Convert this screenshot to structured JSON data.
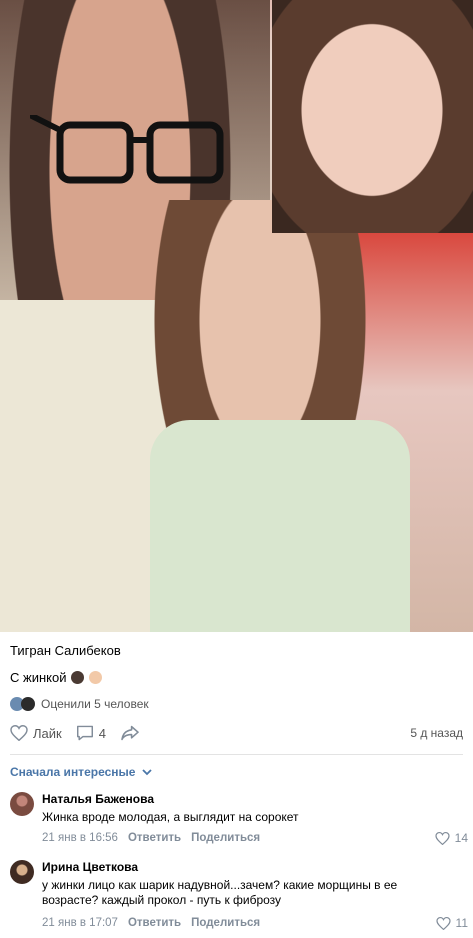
{
  "post": {
    "author": "Тигран Салибеков",
    "text": "С жинкой",
    "rated_text": "Оценили 5 человек",
    "like_label": "Лайк",
    "comments_count": "4",
    "time_ago": "5 д назад"
  },
  "comments_header": {
    "sort_label": "Сначала интересные"
  },
  "comments": [
    {
      "name": "Наталья Баженова",
      "text": "Жинка вроде молодая, а выглядит на сорокет",
      "date": "21 янв в 16:56",
      "reply_label": "Ответить",
      "share_label": "Поделиться",
      "likes": "14"
    },
    {
      "name": "Ирина Цветкова",
      "text": "у жинки лицо как шарик надувной...зачем? какие морщины в ее возрасте? каждый прокол - путь к фиброзу",
      "date": "21 янв в 17:07",
      "reply_label": "Ответить",
      "share_label": "Поделиться",
      "likes": "11"
    }
  ]
}
